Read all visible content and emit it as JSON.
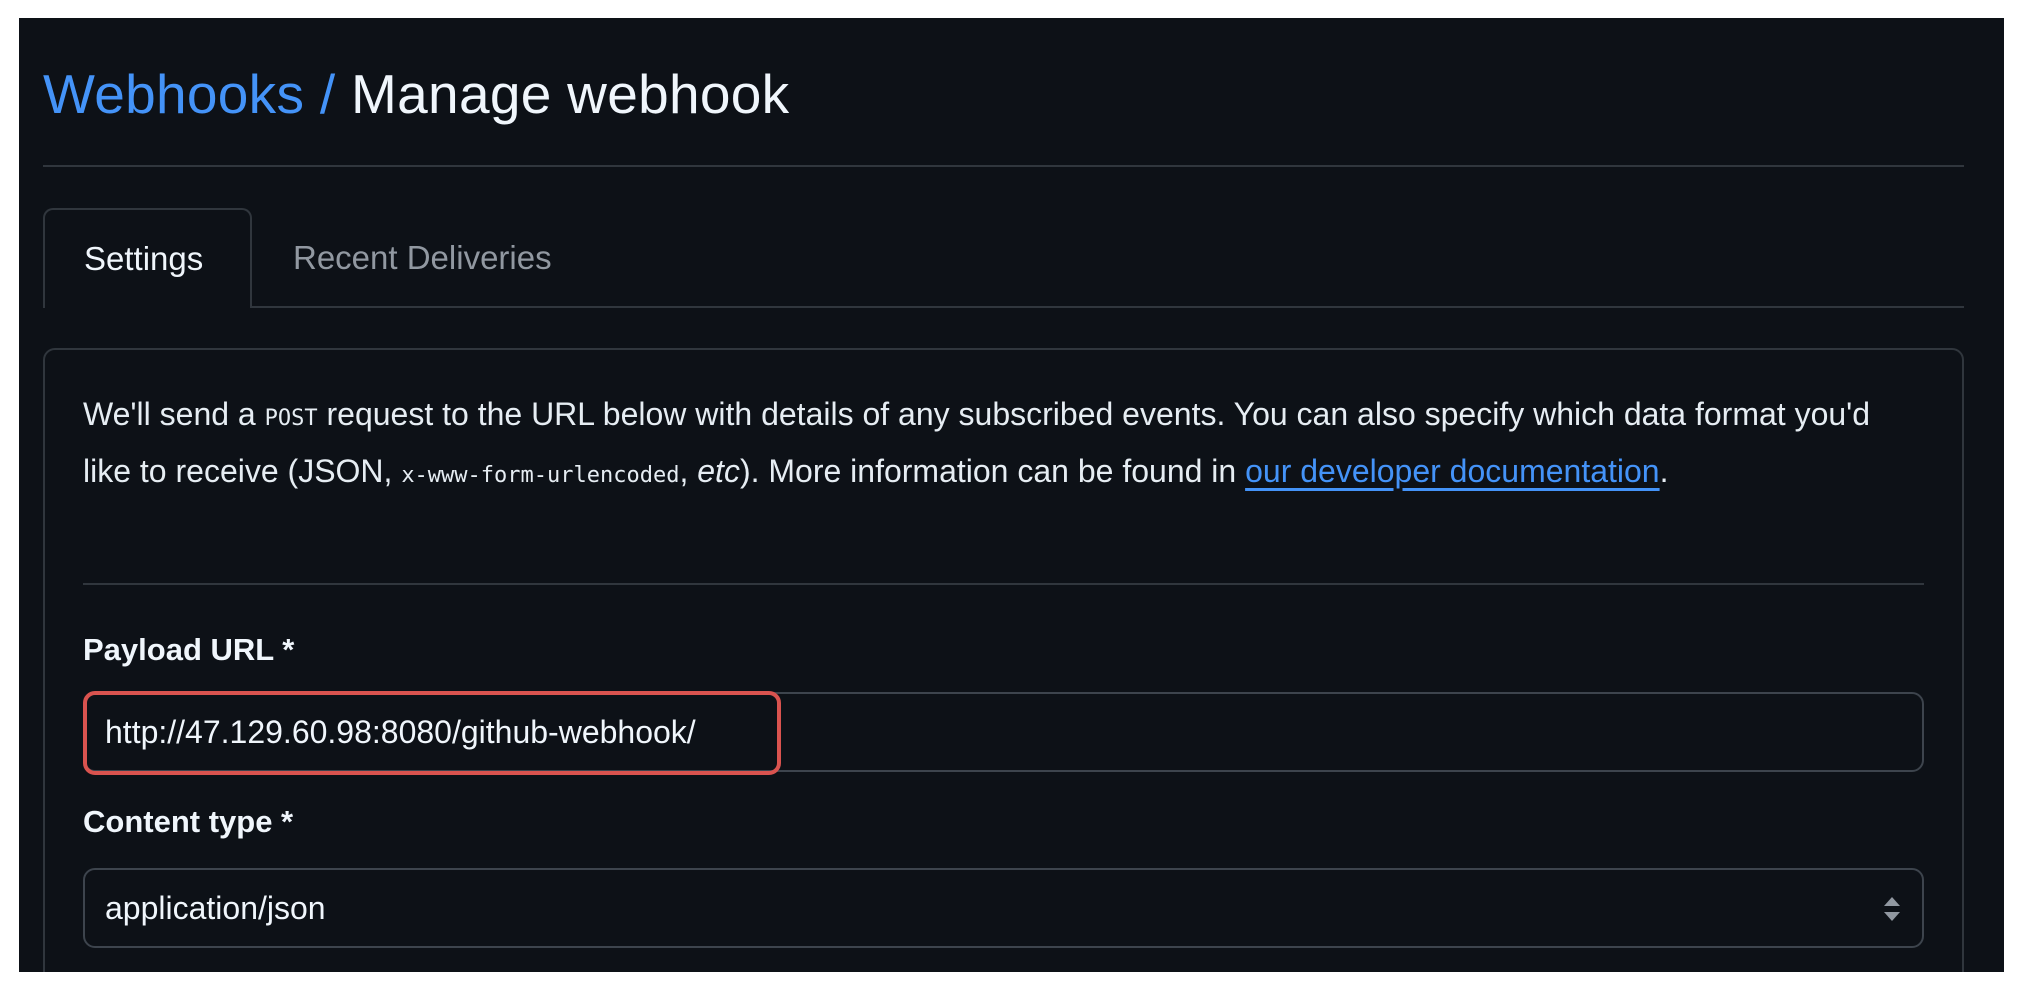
{
  "breadcrumb": {
    "parent": "Webhooks",
    "separator": "/",
    "current": "Manage webhook"
  },
  "tabs": [
    {
      "label": "Settings",
      "active": true
    },
    {
      "label": "Recent Deliveries",
      "active": false
    }
  ],
  "intro": {
    "part1": "We'll send a ",
    "method": "POST",
    "part2": " request to the URL below with details of any subscribed events. You can also specify which data format you'd like to receive (JSON, ",
    "format_code": "x-www-form-urlencoded",
    "part3": ", ",
    "etc": "etc",
    "part4": "). More information can be found in ",
    "link_text": "our developer documentation",
    "part5": "."
  },
  "form": {
    "payload_url": {
      "label": "Payload URL *",
      "value": "http://47.129.60.98:8080/github-webhook/"
    },
    "content_type": {
      "label": "Content type *",
      "value": "application/json"
    }
  },
  "icons": {
    "select": "select-arrows-icon"
  },
  "colors": {
    "background": "#0d1117",
    "link": "#4493f8",
    "border": "#30363d",
    "highlight": "#d9534f",
    "text": "#e6edf3",
    "muted": "#9198a1"
  }
}
